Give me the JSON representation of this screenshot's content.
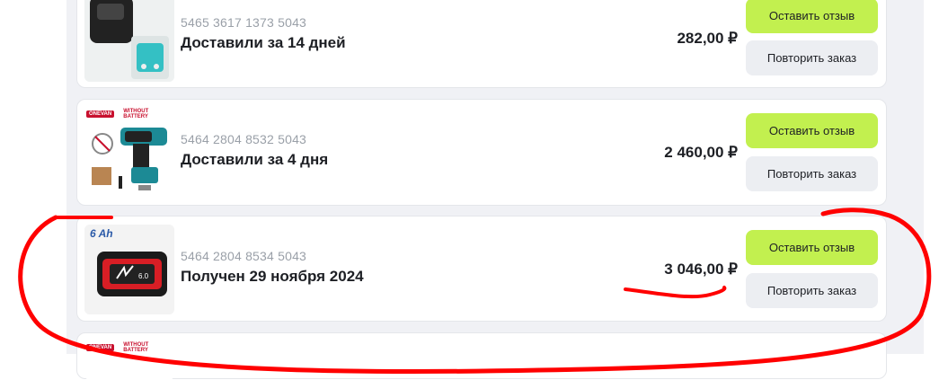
{
  "orders": [
    {
      "number": "5465 3617 1373 5043",
      "status": "Доставили за 14 дней",
      "price": "282,00 ₽",
      "review_label": "Оставить отзыв",
      "repeat_label": "Повторить заказ",
      "image_icon": "battery-adapter-image"
    },
    {
      "number": "5464 2804 8532 5043",
      "status": "Доставили за 4 дня",
      "price": "2 460,00 ₽",
      "review_label": "Оставить отзыв",
      "repeat_label": "Повторить заказ",
      "image_icon": "impact-wrench-image",
      "banner_brand": "ONEVAN",
      "banner_text": "WITHOUT BATTERY"
    },
    {
      "number": "5464 2804 8534 5043",
      "status": "Получен 29 ноября 2024",
      "price": "3 046,00 ₽",
      "review_label": "Оставить отзыв",
      "repeat_label": "Повторить заказ",
      "image_icon": "battery-pack-image",
      "image_label": "6 Ah"
    },
    {
      "image_icon": "product-image",
      "banner_brand": "ONEVAN",
      "banner_text": "WITHOUT BATTERY"
    }
  ],
  "colors": {
    "accent_button": "#c2f04f",
    "secondary_button": "#eceef2",
    "annotation": "#ff0000"
  }
}
